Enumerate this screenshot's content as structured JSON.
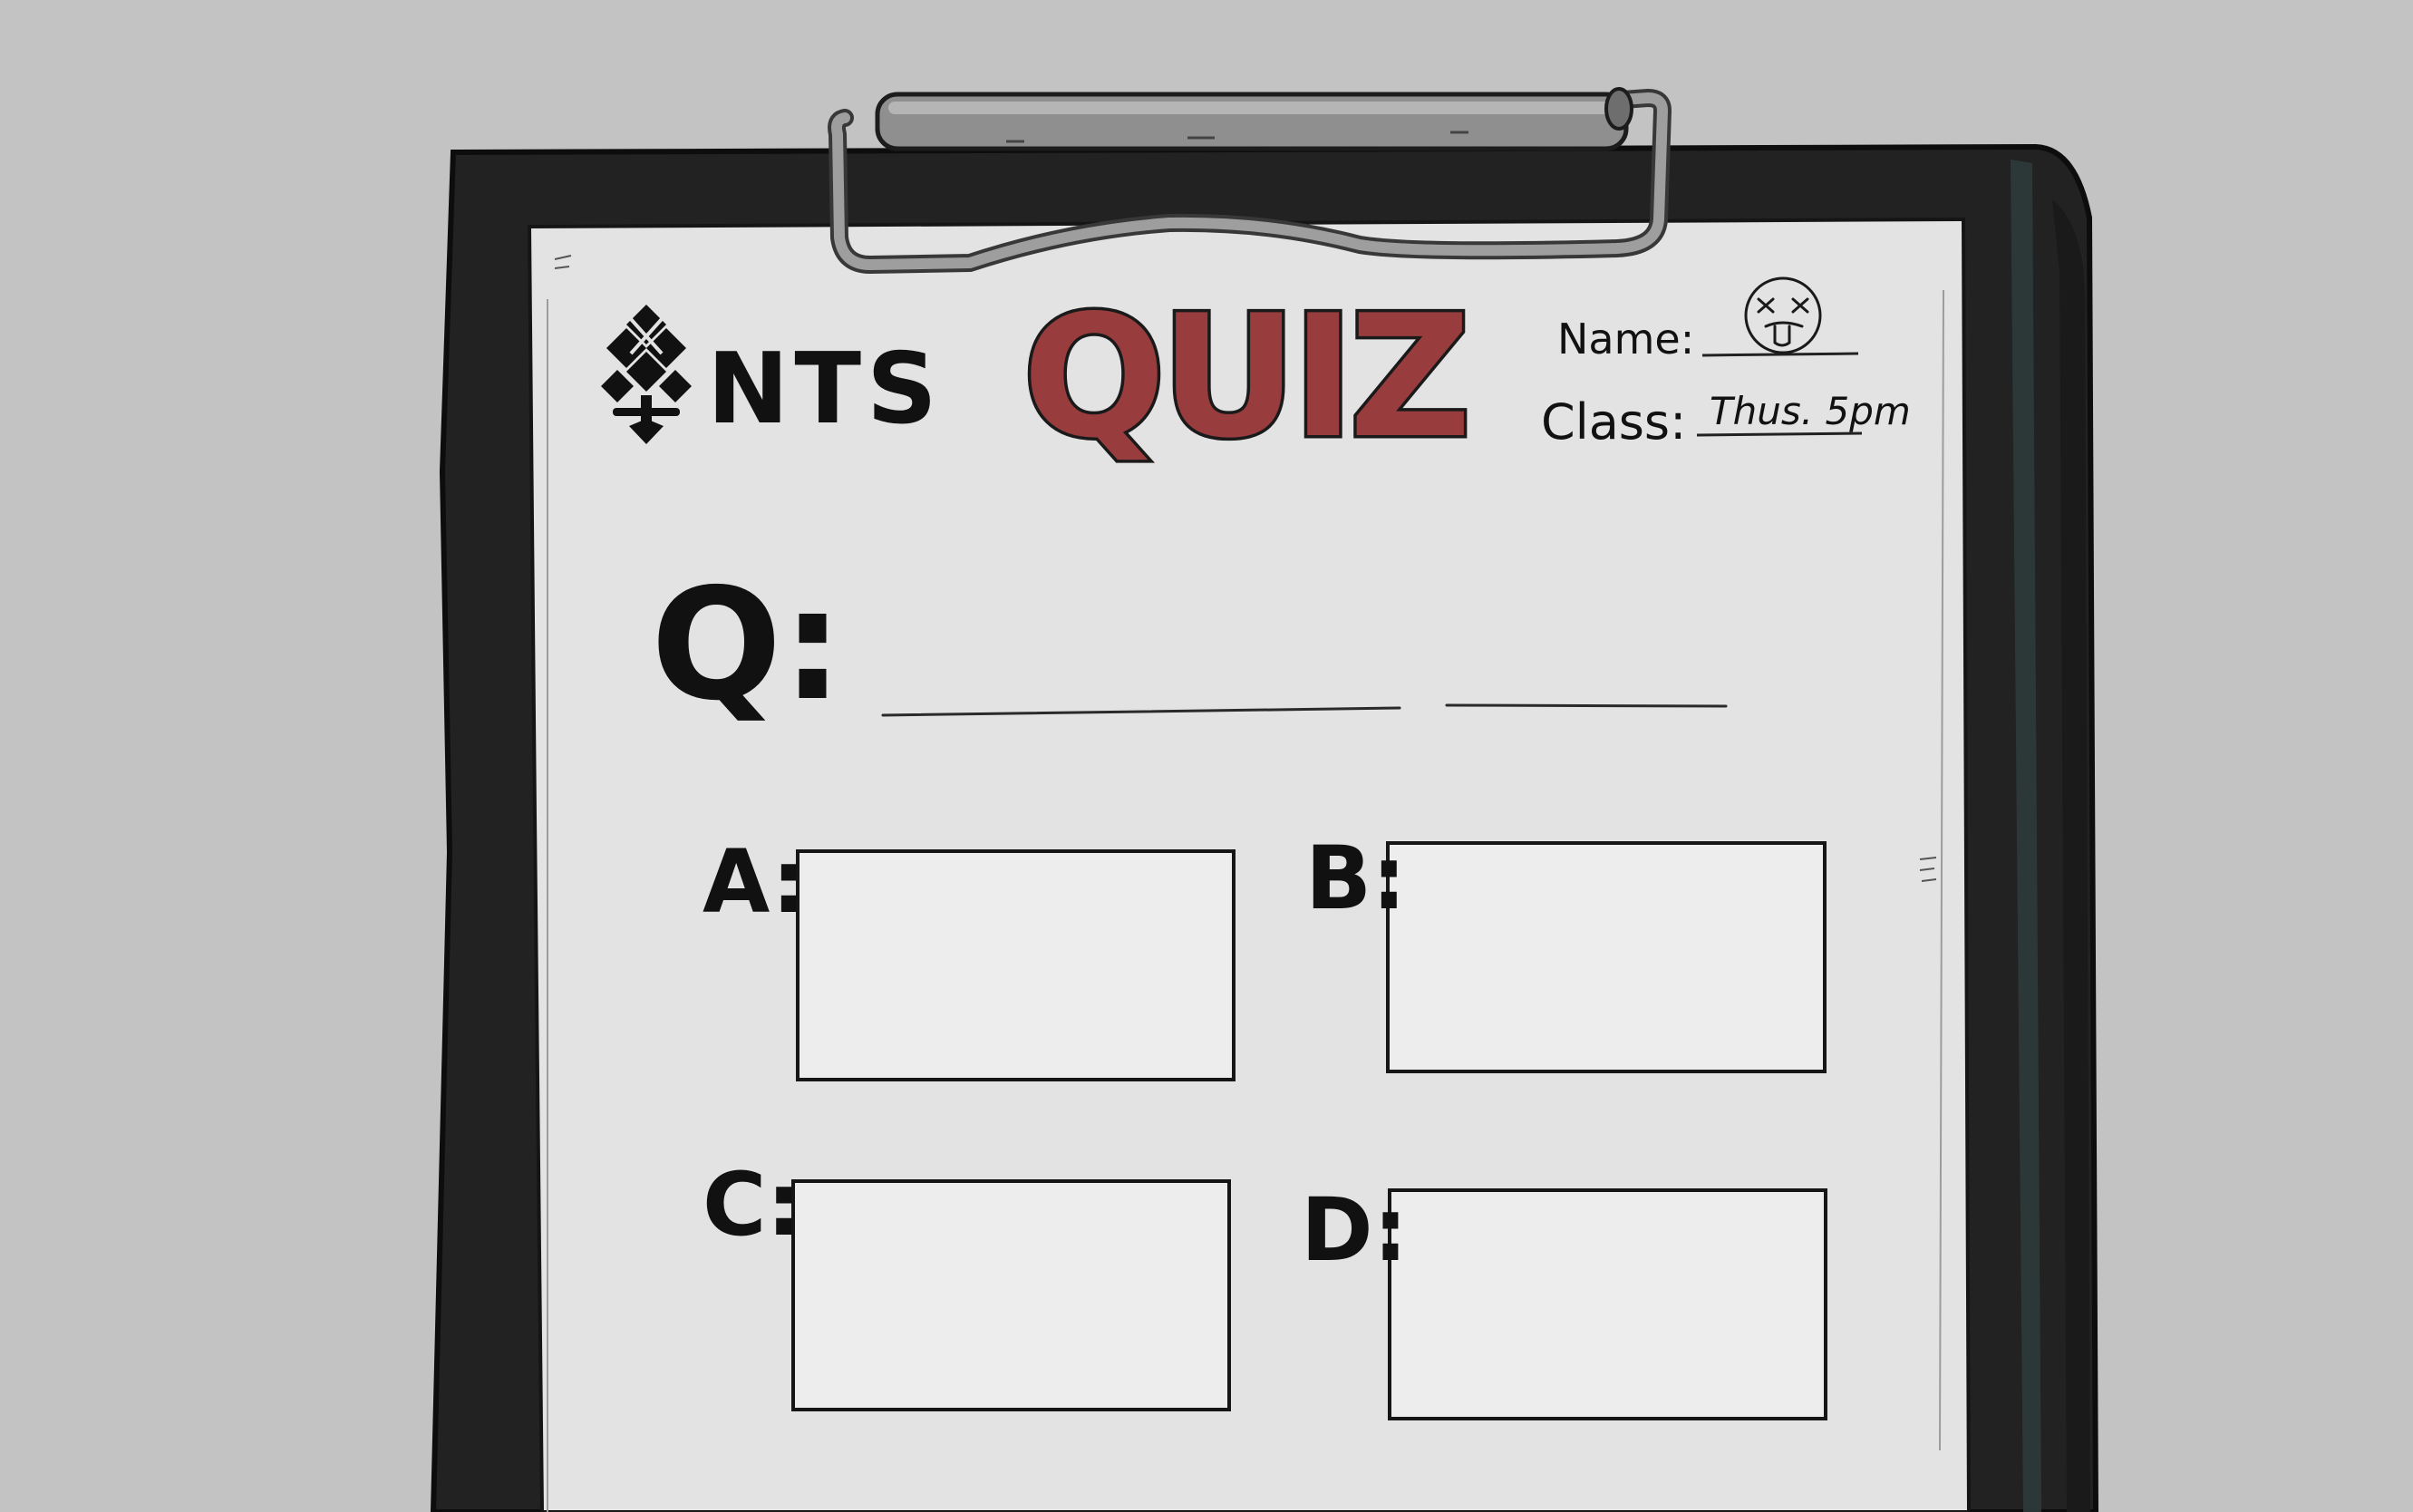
{
  "background_color": "#c3c3c3",
  "board_color": "#232323",
  "paper_color": "#e3e3e3",
  "brand": {
    "logo_icon": "tree-knot-logo-icon",
    "name": "NTS"
  },
  "title": {
    "text": "QUIZ",
    "fill": "#983c3d"
  },
  "form": {
    "name_label": "Name:",
    "name_value_icon": "dizzy-face-doodle-icon",
    "class_label": "Class:",
    "class_value": "Thus. 5pm"
  },
  "question": {
    "label": "Q:",
    "text": ""
  },
  "answers": [
    {
      "label": "A:",
      "text": ""
    },
    {
      "label": "B:",
      "text": ""
    },
    {
      "label": "C:",
      "text": ""
    },
    {
      "label": "D:",
      "text": ""
    }
  ]
}
